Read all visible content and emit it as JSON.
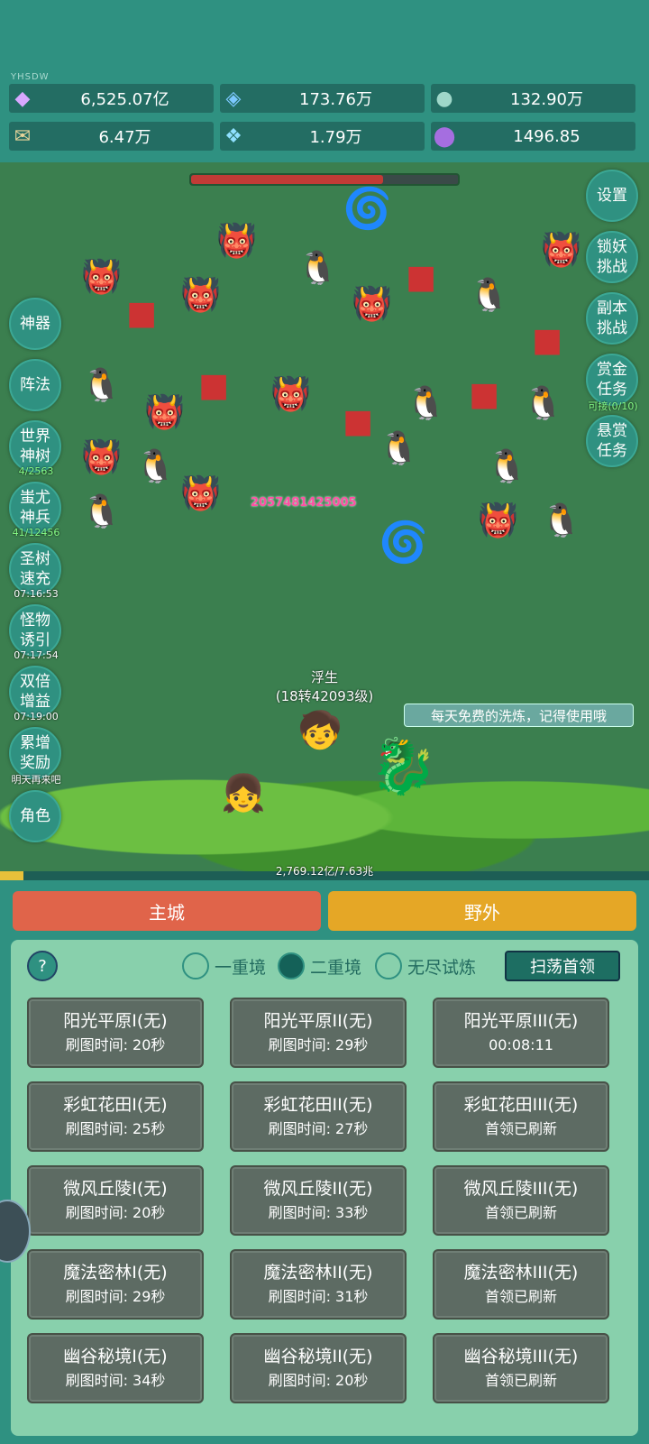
{
  "watermark": "YHSDW",
  "resources": [
    {
      "icon": "diamond-icon",
      "value": "6,525.07亿",
      "color": "#d8a8ff"
    },
    {
      "icon": "blue-gem-icon",
      "value": "173.76万",
      "color": "#7cc8ff"
    },
    {
      "icon": "earth-orb-icon",
      "value": "132.90万",
      "color": "#7fb7a9"
    },
    {
      "icon": "scroll-icon",
      "value": "6.47万",
      "color": "#e8d49a"
    },
    {
      "icon": "ice-crystal-icon",
      "value": "1.79万",
      "color": "#8fe0ff"
    },
    {
      "icon": "purple-pot-icon",
      "value": "1496.85",
      "color": "#8a4fbf"
    }
  ],
  "boss_hp_fraction": 0.72,
  "left_buttons": [
    {
      "label": "神器",
      "sub": ""
    },
    {
      "label": "阵法",
      "sub": ""
    },
    {
      "label": "世界神树",
      "sub": "4/2563"
    },
    {
      "label": "蚩尤神兵",
      "sub": "41/12456"
    },
    {
      "label": "圣树速充",
      "sub": "07:16:53"
    },
    {
      "label": "怪物诱引",
      "sub": "07:17:54"
    },
    {
      "label": "双倍增益",
      "sub": "07:19:00"
    },
    {
      "label": "累增奖励",
      "sub": "明天再来吧"
    },
    {
      "label": "角色",
      "sub": ""
    }
  ],
  "right_buttons": [
    {
      "label": "设置",
      "sub": ""
    },
    {
      "label": "锁妖挑战",
      "sub": ""
    },
    {
      "label": "副本挑战",
      "sub": ""
    },
    {
      "label": "赏金任务",
      "sub": "可接(0/10)"
    },
    {
      "label": "悬赏任务",
      "sub": ""
    }
  ],
  "damage_number": "2057481425005",
  "hero": {
    "name": "浮生",
    "level": "(18转42093级)"
  },
  "tip": "每天免费的洗炼，记得使用哦",
  "exp": {
    "text": "2,769.12亿/7.63兆",
    "fraction": 0.036
  },
  "tabs": {
    "city": "主城",
    "wild": "野外"
  },
  "modes": [
    {
      "label": "一重境",
      "selected": false
    },
    {
      "label": "二重境",
      "selected": true
    },
    {
      "label": "无尽试炼",
      "selected": false
    }
  ],
  "help_label": "?",
  "sweep_label": "扫荡首领",
  "stages": [
    {
      "name": "阳光平原I(无)",
      "info": "刷图时间: 20秒"
    },
    {
      "name": "阳光平原II(无)",
      "info": "刷图时间: 29秒"
    },
    {
      "name": "阳光平原III(无)",
      "info": "00:08:11"
    },
    {
      "name": "彩虹花田I(无)",
      "info": "刷图时间: 25秒"
    },
    {
      "name": "彩虹花田II(无)",
      "info": "刷图时间: 27秒"
    },
    {
      "name": "彩虹花田III(无)",
      "info": "首领已刷新"
    },
    {
      "name": "微风丘陵I(无)",
      "info": "刷图时间: 20秒"
    },
    {
      "name": "微风丘陵II(无)",
      "info": "刷图时间: 33秒"
    },
    {
      "name": "微风丘陵III(无)",
      "info": "首领已刷新"
    },
    {
      "name": "魔法密林I(无)",
      "info": "刷图时间: 29秒"
    },
    {
      "name": "魔法密林II(无)",
      "info": "刷图时间: 31秒"
    },
    {
      "name": "魔法密林III(无)",
      "info": "首领已刷新"
    },
    {
      "name": "幽谷秘境I(无)",
      "info": "刷图时间: 34秒"
    },
    {
      "name": "幽谷秘境II(无)",
      "info": "刷图时间: 20秒"
    },
    {
      "name": "幽谷秘境III(无)",
      "info": "首领已刷新"
    }
  ]
}
